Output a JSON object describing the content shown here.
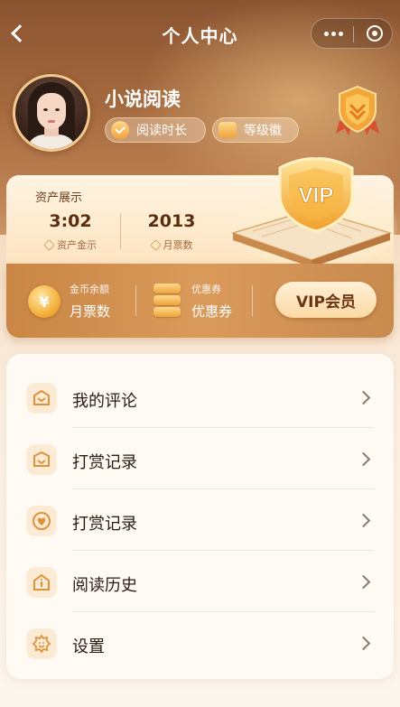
{
  "nav": {
    "title": "个人中心"
  },
  "profile": {
    "username": "小说阅读",
    "tags": [
      {
        "label": "阅读时长",
        "icon": "check-coin-icon"
      },
      {
        "label": "等级徽",
        "icon": "cube-icon"
      }
    ],
    "badge_icon": "shield-rank-badge-icon"
  },
  "assets": {
    "title": "资产展示",
    "stats": [
      {
        "value": "3:02",
        "label": "资产金示"
      },
      {
        "value": "2013",
        "label": "月票数"
      }
    ],
    "vip_art_label": "VIP"
  },
  "gold_bar": {
    "coin_symbol": "¥",
    "coin": {
      "small": "金币余额",
      "big": "月票数"
    },
    "coupon": {
      "small": "优惠券",
      "big": "优惠券"
    },
    "vip_button": "VIP会员"
  },
  "menu": {
    "items": [
      {
        "label": "我的评论",
        "icon": "comment-envelope-icon"
      },
      {
        "label": "打赏记录",
        "icon": "gift-box-icon"
      },
      {
        "label": "打赏记录",
        "icon": "heart-icon"
      },
      {
        "label": "阅读历史",
        "icon": "book-house-icon"
      },
      {
        "label": "设置",
        "icon": "settings-smile-icon"
      }
    ]
  },
  "colors": {
    "accent": "#e9a34a",
    "hero_top": "#8a5431",
    "vip_button": "#fbd9a4",
    "text_dark": "#2b1b10"
  }
}
